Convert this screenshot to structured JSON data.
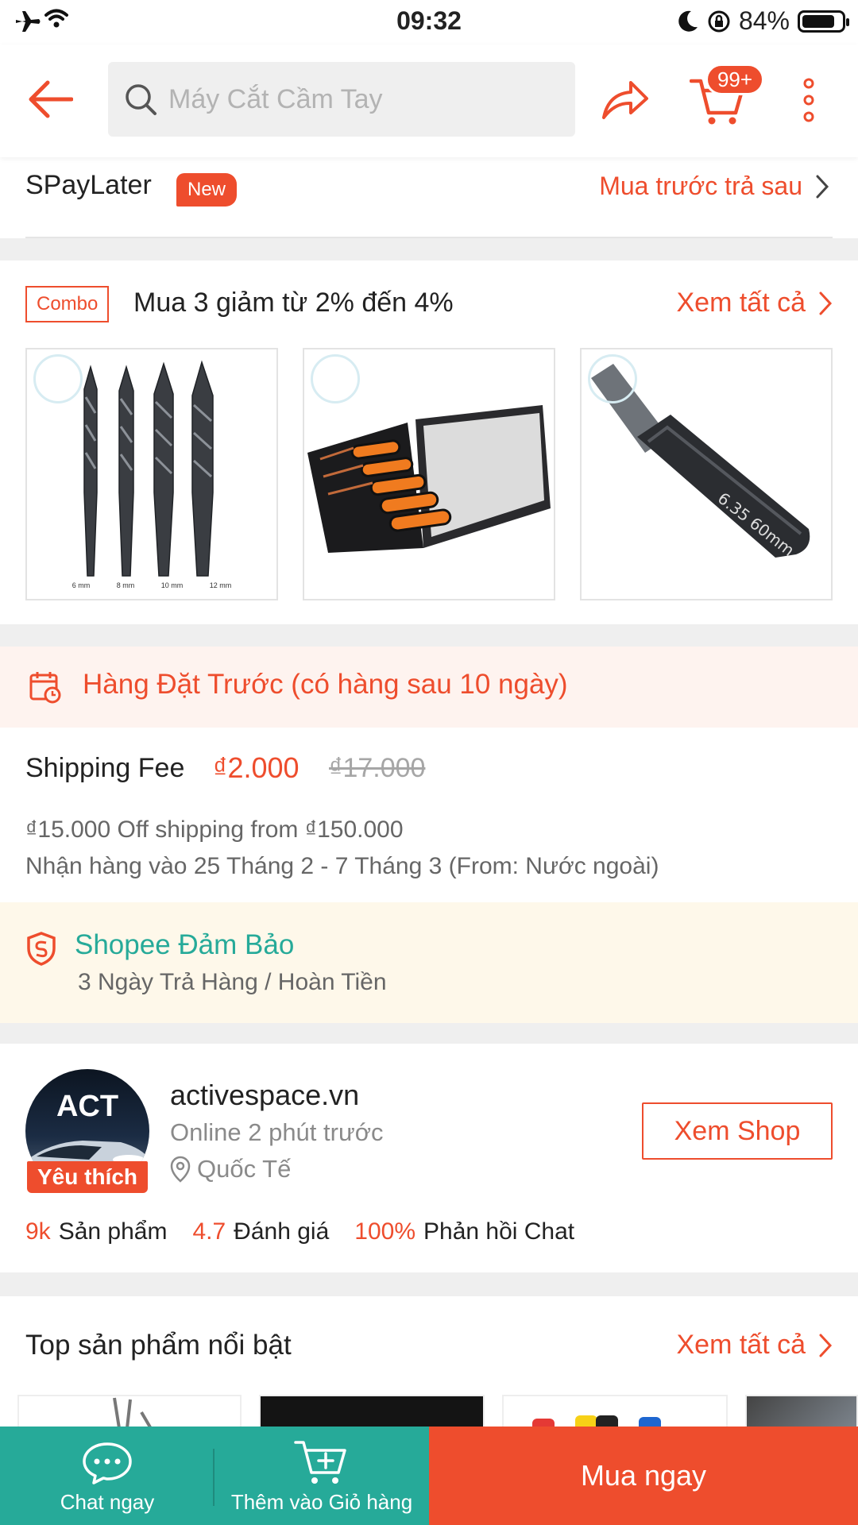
{
  "status_bar": {
    "time": "09:32",
    "battery": "84%"
  },
  "header": {
    "search_placeholder": "Máy Cắt Cầm Tay",
    "cart_badge": "99+"
  },
  "spaylater": {
    "title": "SPayLater",
    "badge": "New",
    "link": "Mua trước trả sau"
  },
  "combo": {
    "tag": "Combo",
    "title": "Mua 3 giảm từ 2% đến 4%",
    "see_all": "Xem tất cả",
    "drill_sizes": [
      "6 mm",
      "8 mm",
      "10 mm",
      "12 mm"
    ],
    "socket_label": "6.35 60mm"
  },
  "preorder": {
    "text": "Hàng Đặt Trước (có hàng sau 10 ngày)"
  },
  "shipping": {
    "label": "Shipping Fee",
    "price": "₫2.000",
    "old_price": "₫17.000",
    "discount": "₫15.000 Off shipping from ₫150.000",
    "eta": "Nhận hàng vào 25 Tháng 2 - 7 Tháng 3 (From: Nước ngoài)"
  },
  "guarantee": {
    "title": "Shopee Đảm Bảo",
    "subtitle": "3 Ngày Trả Hàng / Hoàn Tiền"
  },
  "shop": {
    "avatar_text": "ACT",
    "favorite_badge": "Yêu thích",
    "name": "activespace.vn",
    "online": "Online 2 phút trước",
    "location": "Quốc Tế",
    "view_button": "Xem Shop",
    "stats": [
      {
        "value": "9k",
        "label": "Sản phẩm"
      },
      {
        "value": "4.7",
        "label": "Đánh giá"
      },
      {
        "value": "100%",
        "label": "Phản hồi Chat"
      }
    ]
  },
  "top_products": {
    "title": "Top sản phẩm nổi bật",
    "see_all": "Xem tất cả"
  },
  "bottom_bar": {
    "chat": "Chat ngay",
    "add_to_cart": "Thêm vào Giỏ hàng",
    "buy_now": "Mua ngay"
  },
  "colors": {
    "accent": "#ee4d2d",
    "teal": "#26aa99",
    "preorder_bg": "#fef3ef",
    "guarantee_bg": "#fef8ea"
  }
}
